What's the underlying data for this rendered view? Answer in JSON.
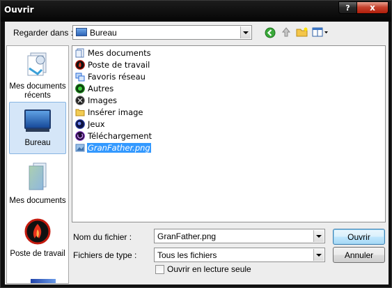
{
  "window": {
    "title": "Ouvrir",
    "help_button": "?",
    "close_button": "x"
  },
  "lookin": {
    "label": "Regarder dans :",
    "value": "Bureau"
  },
  "places": [
    {
      "label": "Mes documents récents",
      "icon": "recent-documents-icon"
    },
    {
      "label": "Bureau",
      "icon": "desktop-icon",
      "selected": true
    },
    {
      "label": "Mes documents",
      "icon": "my-documents-icon"
    },
    {
      "label": "Poste de travail",
      "icon": "computer-icon"
    }
  ],
  "files": [
    {
      "name": "Mes documents",
      "icon": "documents-icon",
      "color": "#5b7fb8"
    },
    {
      "name": "Poste de travail",
      "icon": "computer-icon",
      "color": "#c41a0e"
    },
    {
      "name": "Favoris réseau",
      "icon": "network-icon",
      "color": "#2c6bd6"
    },
    {
      "name": "Autres",
      "icon": "green-orb-icon",
      "color": "#1d8a1d"
    },
    {
      "name": "Images",
      "icon": "images-icon",
      "color": "#222222"
    },
    {
      "name": "Insérer image",
      "icon": "folder-icon",
      "color": "#f2cc54"
    },
    {
      "name": "Jeux",
      "icon": "games-icon",
      "color": "#2a3fa8"
    },
    {
      "name": "Téléchargement",
      "icon": "download-icon",
      "color": "#7a2fb8"
    },
    {
      "name": "GranFather.png",
      "icon": "png-file-icon",
      "color": "#4d7fbf",
      "selected": true
    }
  ],
  "filename": {
    "label": "Nom du fichier :",
    "value": "GranFather.png"
  },
  "filetype": {
    "label": "Fichiers de type :",
    "value": "Tous les fichiers"
  },
  "readonly": {
    "label": "Ouvrir en lecture seule"
  },
  "buttons": {
    "open": "Ouvrir",
    "cancel": "Annuler"
  },
  "colors": {
    "selection": "#3399ff",
    "close": "#c64430"
  }
}
